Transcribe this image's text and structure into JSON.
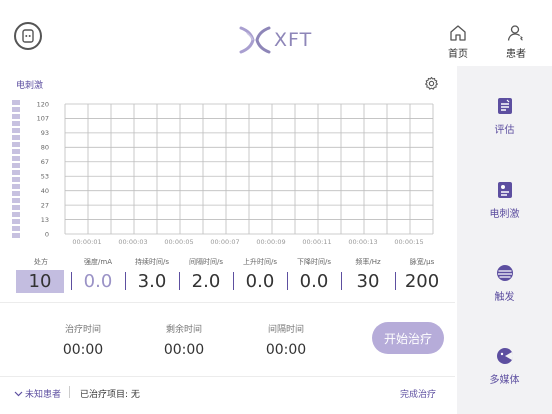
{
  "header": {
    "logo_text": "XFT",
    "nav": [
      {
        "label": "首页",
        "icon": "home-icon"
      },
      {
        "label": "患者",
        "icon": "patient-icon"
      }
    ]
  },
  "sidebar": {
    "items": [
      {
        "label": "评估",
        "icon": "evaluation-icon"
      },
      {
        "label": "电刺激",
        "icon": "stimulation-icon"
      },
      {
        "label": "触发",
        "icon": "trigger-icon"
      },
      {
        "label": "多媒体",
        "icon": "multimedia-icon"
      }
    ]
  },
  "panel": {
    "title": "电刺激"
  },
  "chart_data": {
    "type": "line",
    "title": "",
    "xlabel": "",
    "ylabel": "",
    "y_ticks": [
      "120",
      "107",
      "93",
      "80",
      "67",
      "53",
      "40",
      "27",
      "13",
      "0"
    ],
    "x_ticks": [
      "00:00:01",
      "00:00:03",
      "00:00:05",
      "00:00:07",
      "00:00:09",
      "00:00:11",
      "00:00:13",
      "00:00:15"
    ],
    "ylim": [
      0,
      120
    ],
    "grid": true,
    "series": []
  },
  "params": {
    "prescription": {
      "label": "处方",
      "value": "10"
    },
    "items": [
      {
        "label": "强度/mA",
        "value": "0.0",
        "dim": true
      },
      {
        "label": "持续时间/s",
        "value": "3.0"
      },
      {
        "label": "间隔时间/s",
        "value": "2.0"
      },
      {
        "label": "上升时间/s",
        "value": "0.0"
      },
      {
        "label": "下降时间/s",
        "value": "0.0"
      },
      {
        "label": "频率/Hz",
        "value": "30"
      },
      {
        "label": "脉宽/μs",
        "value": "200"
      }
    ]
  },
  "timers": [
    {
      "label": "治疗时间",
      "value": "00:00"
    },
    {
      "label": "剩余时间",
      "value": "00:00"
    },
    {
      "label": "间隔时间",
      "value": "00:00"
    }
  ],
  "start_button": {
    "label": "开始治疗"
  },
  "footer": {
    "patient_label": "未知患者",
    "treated_label": "已治疗项目: 无",
    "finish_label": "完成治疗"
  },
  "colors": {
    "accent": "#5d4fa0",
    "accent_light": "#b6acd9",
    "level_bar": "#c7c1e0"
  }
}
